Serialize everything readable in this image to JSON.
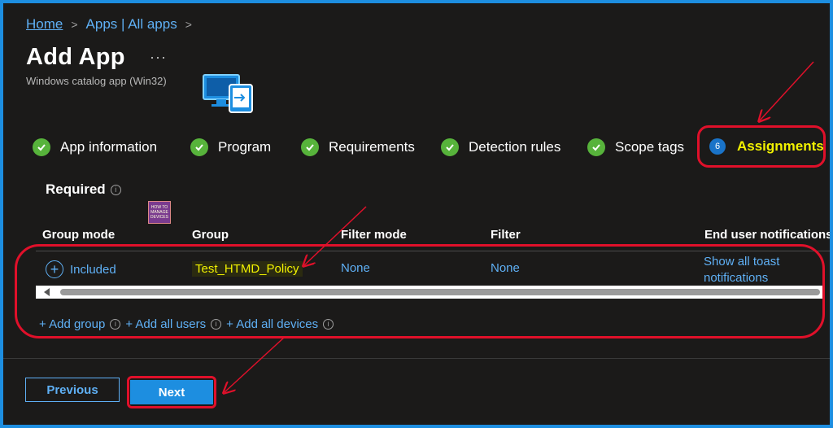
{
  "breadcrumb": {
    "home": "Home",
    "sep1": ">",
    "apps": "Apps | All apps",
    "sep2": ">"
  },
  "header": {
    "title": "Add App",
    "more": "···",
    "subtitle": "Windows catalog app (Win32)"
  },
  "steps": [
    {
      "label": "App information",
      "status": "complete"
    },
    {
      "label": "Program",
      "status": "complete"
    },
    {
      "label": "Requirements",
      "status": "complete"
    },
    {
      "label": "Detection rules",
      "status": "complete"
    },
    {
      "label": "Scope tags",
      "status": "complete"
    },
    {
      "label": "Assignments",
      "number": "6",
      "status": "active"
    }
  ],
  "section": {
    "title": "Required",
    "info": "i"
  },
  "logo": {
    "text": "HOW TO MANAGE DEVICES"
  },
  "table": {
    "columns": [
      "Group mode",
      "Group",
      "Filter mode",
      "Filter",
      "End user notifications"
    ],
    "row": {
      "group_mode": "Included",
      "group": "Test_HTMD_Policy",
      "filter_mode": "None",
      "filter": "None",
      "notification_line1": "Show all toast",
      "notification_line2": "notifications"
    }
  },
  "add_links": {
    "add_group": "+ Add group",
    "add_all_users": "+ Add all users",
    "add_all_devices": "+ Add all devices"
  },
  "footer": {
    "previous": "Previous",
    "next": "Next"
  },
  "colors": {
    "accent": "#1d8ee0",
    "highlight": "#f2f200",
    "annotation": "#e0102a",
    "success": "#57b33b"
  }
}
